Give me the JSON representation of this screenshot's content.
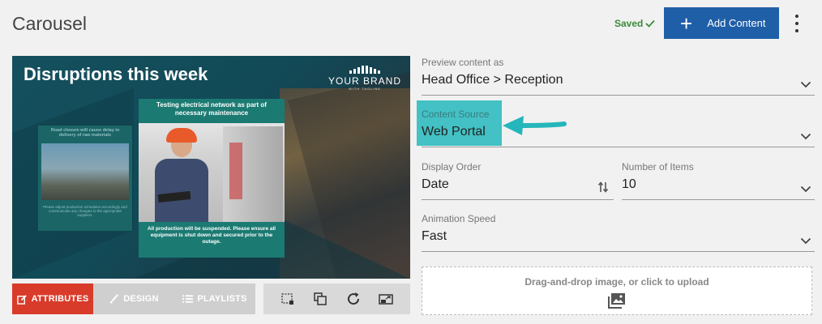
{
  "header": {
    "title": "Carousel",
    "saved_label": "Saved",
    "add_button_label": "Add Content"
  },
  "slide": {
    "title": "Disruptions this week",
    "brand_name": "YOUR BRAND",
    "brand_tagline": "WITH TAGLINE",
    "small_card_title": "Road closure will cause delay in delivery of raw materials",
    "small_card_body": "Please adjust production schedules accordingly and communicate any changes to the appropriate suppliers.",
    "main_card_title": "Testing electrical network as part of necessary maintenance",
    "main_card_body": "All production will be suspended. Please ensure all equipment is shut down and secured prior to the outage."
  },
  "toolbar": {
    "attributes_label": "ATTRIBUTES",
    "design_label": "DESIGN",
    "playlists_label": "PLAYLISTS",
    "accent_color": "#d93b2b"
  },
  "form": {
    "preview_label": "Preview content as",
    "preview_value": "Head Office > Reception",
    "source_label": "Content Source",
    "source_value": "Web Portal",
    "order_label": "Display Order",
    "order_value": "Date",
    "items_label": "Number of Items",
    "items_value": "10",
    "speed_label": "Animation Speed",
    "speed_value": "Fast",
    "upload_text": "Drag-and-drop image, or click to upload"
  },
  "colors": {
    "primary": "#1f5fa8",
    "highlight": "#43c1c4",
    "saved": "#3c8a3c"
  }
}
